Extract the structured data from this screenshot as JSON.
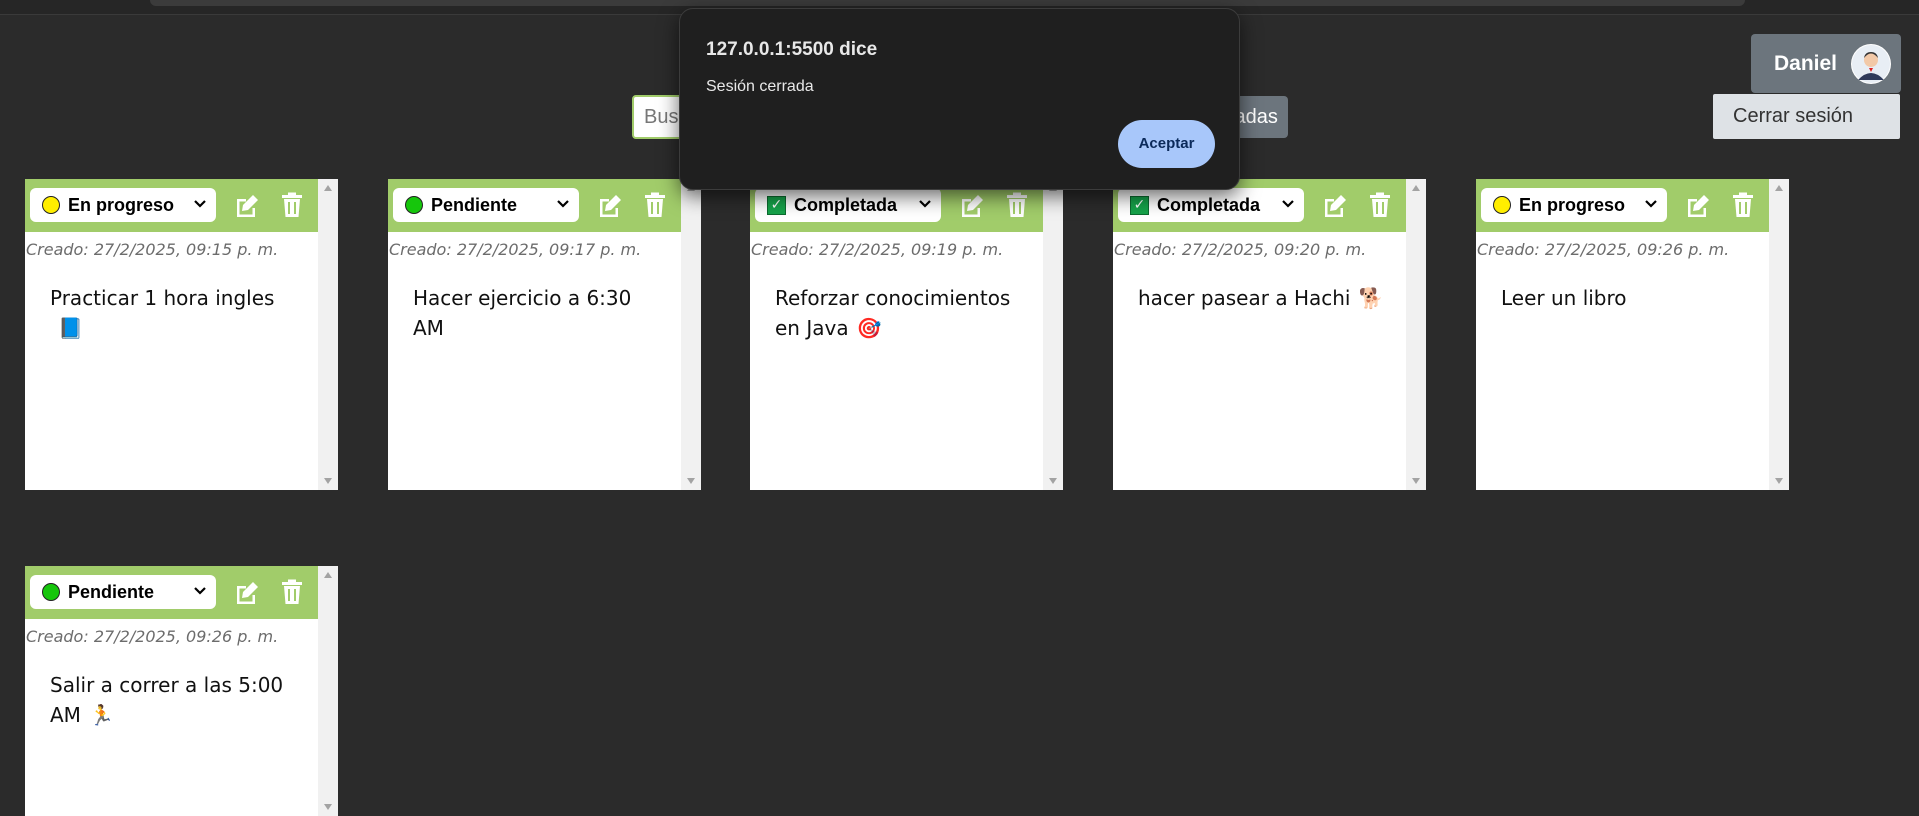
{
  "search": {
    "placeholder": "Buscar"
  },
  "filter_button_label": "Completadas",
  "user": {
    "name": "Daniel",
    "menu": {
      "logout_label": "Cerrar sesión"
    }
  },
  "notes": [
    {
      "status": "En progreso",
      "status_icon": "yellow-circle",
      "created": "Creado: 27/2/2025, 09:15 p. m.",
      "text": "Practicar 1 hora ingles",
      "emoji": "📘"
    },
    {
      "status": "Pendiente",
      "status_icon": "green-circle",
      "created": "Creado: 27/2/2025, 09:17 p. m.",
      "text": "Hacer ejercicio a 6:30 AM",
      "emoji": ""
    },
    {
      "status": "Completada",
      "status_icon": "check-box",
      "created": "Creado: 27/2/2025, 09:19 p. m.",
      "text": "Reforzar conocimientos en Java",
      "emoji": "🎯"
    },
    {
      "status": "Completada",
      "status_icon": "check-box",
      "created": "Creado: 27/2/2025, 09:20 p. m.",
      "text": "hacer pasear a Hachi",
      "emoji": "🐕"
    },
    {
      "status": "En progreso",
      "status_icon": "yellow-circle",
      "created": "Creado: 27/2/2025, 09:26 p. m.",
      "text": "Leer un libro",
      "emoji": ""
    },
    {
      "status": "Pendiente",
      "status_icon": "green-circle",
      "created": "Creado: 27/2/2025, 09:26 p. m.",
      "text": "Salir a correr a las 5:00 AM",
      "emoji": "🏃"
    }
  ],
  "dialog": {
    "title": "127.0.0.1:5500 dice",
    "message": "Sesión cerrada",
    "ok_label": "Aceptar"
  },
  "colors": {
    "background": "#2b2b2b",
    "note_header": "#a1cc6a",
    "dialog_button": "#a8c7fa",
    "secondary_button": "#6c757d"
  }
}
